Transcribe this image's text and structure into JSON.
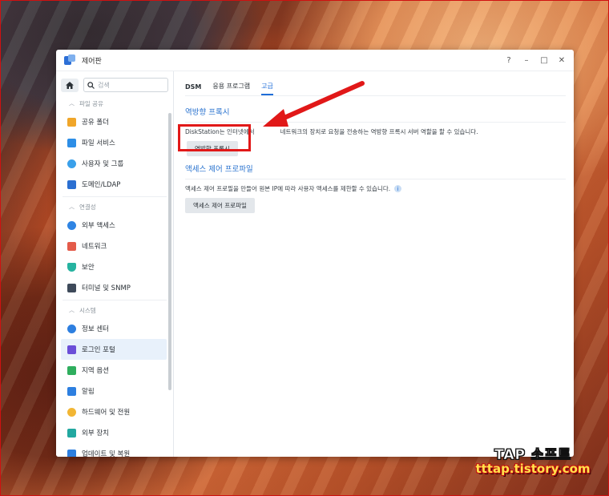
{
  "window": {
    "title": "제어판",
    "help": "?",
    "minimize": "–",
    "maximize": "□",
    "close": "✕"
  },
  "sidebar": {
    "home_icon": "home-icon",
    "search_placeholder": "검색",
    "groups": [
      {
        "label": "파일 공유",
        "items": [
          {
            "label": "공유 폴더",
            "icon": "shared-folder-icon",
            "color": "#f0a62a"
          },
          {
            "label": "파일 서비스",
            "icon": "file-services-icon",
            "color": "#2d8ee6"
          },
          {
            "label": "사용자 및 그룹",
            "icon": "users-icon",
            "color": "#3aa0ea"
          },
          {
            "label": "도메인/LDAP",
            "icon": "domain-icon",
            "color": "#2b6fd1"
          }
        ]
      },
      {
        "label": "연결성",
        "items": [
          {
            "label": "외부 액세스",
            "icon": "external-access-icon",
            "color": "#2f84e3"
          },
          {
            "label": "네트워크",
            "icon": "network-icon",
            "color": "#e45b4a"
          },
          {
            "label": "보안",
            "icon": "security-icon",
            "color": "#26b3a0"
          },
          {
            "label": "터미널 및 SNMP",
            "icon": "terminal-icon",
            "color": "#3e4a5a"
          }
        ]
      },
      {
        "label": "시스템",
        "items": [
          {
            "label": "정보 센터",
            "icon": "info-center-icon",
            "color": "#2d7fe0"
          },
          {
            "label": "로그인 포털",
            "icon": "login-portal-icon",
            "color": "#6b4fd8",
            "active": true
          },
          {
            "label": "지역 옵션",
            "icon": "regional-options-icon",
            "color": "#2fae5e"
          },
          {
            "label": "알림",
            "icon": "notification-icon",
            "color": "#2d7fe0"
          },
          {
            "label": "하드웨어 및 전원",
            "icon": "hardware-icon",
            "color": "#f2b634"
          },
          {
            "label": "외부 장치",
            "icon": "external-devices-icon",
            "color": "#22a8a0"
          },
          {
            "label": "업데이트 및 복원",
            "icon": "update-icon",
            "color": "#2d7fe0"
          }
        ]
      }
    ]
  },
  "tabs": [
    {
      "label": "DSM"
    },
    {
      "label": "응용 프로그램"
    },
    {
      "label": "고급",
      "active": true
    }
  ],
  "reverse_proxy": {
    "title": "역방향 프록시",
    "description_left": "DiskStation는 인터넷에서",
    "description_right": "네트워크의 장치로 요청을 전송하는 역방향 프록시 서버 역할을 할 수 있습니다.",
    "button": "역방향 프록시"
  },
  "access_profile": {
    "title": "액세스 제어 프로파일",
    "description": "액세스 제어 프로필을 만들어 원본 IP에 따라 사용자 액세스를 제한할 수 있습니다.",
    "button": "액세스 제어 프로파일"
  },
  "annotation": {
    "highlight_color": "#e11818"
  },
  "watermark": {
    "line1": "TAP 소프트",
    "line2": "tttap.tistory.com"
  }
}
